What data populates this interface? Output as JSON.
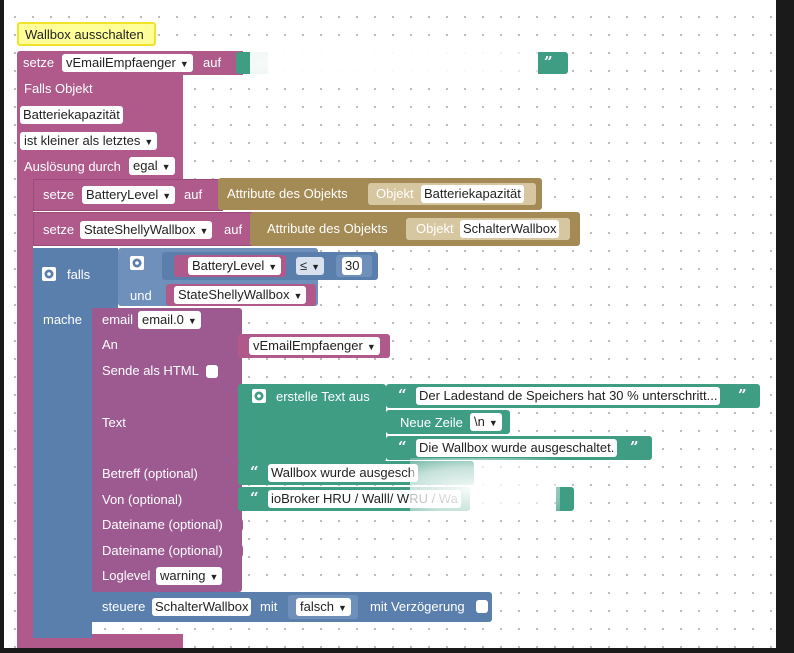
{
  "comment_label": "Wallbox ausschalten",
  "set_block": {
    "setze": "setze",
    "var": "vEmailEmpfaenger",
    "auf": "auf"
  },
  "trigger": {
    "falls_objekt": "Falls Objekt",
    "object": "Batteriekapazität",
    "condition": "ist kleiner als letztes",
    "ausloesung": "Auslösung durch",
    "ausloesung_value": "egal"
  },
  "set_battery": {
    "setze": "setze",
    "var": "BatteryLevel",
    "auf": "auf",
    "attr": "Attribute des Objekts",
    "objekt": "Objekt",
    "object": "Batteriekapazität"
  },
  "set_state": {
    "setze": "setze",
    "var": "StateShellyWallbox",
    "auf": "auf",
    "attr": "Attribute des Objekts",
    "objekt": "Objekt",
    "object": "SchalterWallbox"
  },
  "if_block": {
    "falls": "falls",
    "und": "und",
    "mache": "mache",
    "var1": "BatteryLevel",
    "op": "≤",
    "num": "30",
    "var2": "StateShellyWallbox"
  },
  "email": {
    "email": "email",
    "instance": "email.0",
    "an": "An",
    "an_var": "vEmailEmpfaenger",
    "html": "Sende als HTML",
    "text": "Text",
    "erstelle": "erstelle Text aus",
    "line1": "Der Ladestand de Speichers hat 30 % unterschritt...",
    "neue_zeile": "Neue Zeile",
    "nl": "\\n",
    "line2": "Die Wallbox wurde ausgeschaltet.",
    "betreff": "Betreff (optional)",
    "betreff_val": "Wallbox wurde ausgesch",
    "von": "Von (optional)",
    "von_val": "ioBroker HRU / Walll/ WRU / Wa",
    "dateiname1": "Dateiname (optional)",
    "dateiname2": "Dateiname (optional)",
    "loglevel": "Loglevel",
    "loglevel_val": "warning"
  },
  "steuere": {
    "steuere": "steuere",
    "object": "SchalterWallbox",
    "mit": "mit",
    "value": "falsch",
    "delay": "mit Verzögerung"
  },
  "colors": {
    "variables": "#b05a8c",
    "logic": "#5a7fad",
    "text": "#3f9d84",
    "object_attr": "#a48a54",
    "comment": "#ffff99"
  }
}
